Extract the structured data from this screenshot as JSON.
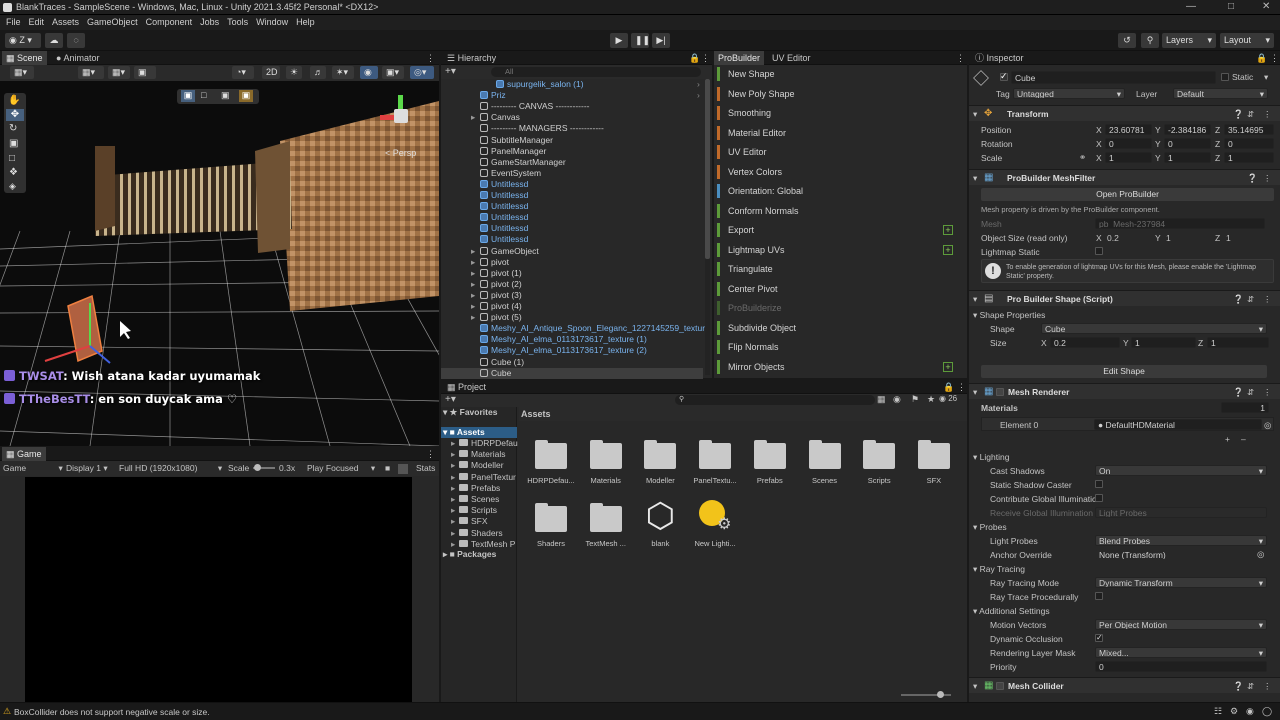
{
  "window": {
    "title": "BlankTraces - SampleScene - Windows, Mac, Linux - Unity 2021.3.45f2 Personal* <DX12>"
  },
  "menu": [
    "File",
    "Edit",
    "Assets",
    "GameObject",
    "Component",
    "Jobs",
    "Tools",
    "Window",
    "Help"
  ],
  "toolbar": {
    "account": "Z",
    "layers": "Layers",
    "layout": "Layout"
  },
  "scene": {
    "tab_scene": "Scene",
    "tab_animator": "Animator",
    "mode_2d": "2D",
    "persp": "< Persp"
  },
  "chat": [
    {
      "user": "TWSAT",
      "msg": ": Wish atana kadar uyumamak"
    },
    {
      "user": "TTheBesTT",
      "msg": ": en son duycak ama ♡"
    }
  ],
  "game": {
    "tab": "Game",
    "display_mode": "Game",
    "display": "Display 1",
    "resolution": "Full HD (1920x1080)",
    "scale_label": "Scale",
    "scale_value": "0.3x",
    "play_focused": "Play Focused",
    "stats": "Stats"
  },
  "hierarchy": {
    "tab": "Hierarchy",
    "search_placeholder": "All",
    "items": [
      {
        "text": "supurgelik_salon (1)",
        "indent": 3,
        "prefab": true
      },
      {
        "text": "Priz",
        "indent": 2,
        "prefab": true
      },
      {
        "text": "--------- CANVAS ------------",
        "indent": 2,
        "prefab": false
      },
      {
        "text": "Canvas",
        "indent": 2,
        "prefab": false,
        "arrow": true
      },
      {
        "text": "--------- MANAGERS ------------",
        "indent": 2,
        "prefab": false
      },
      {
        "text": "SubtitleManager",
        "indent": 2,
        "prefab": false
      },
      {
        "text": "PanelManager",
        "indent": 2,
        "prefab": false
      },
      {
        "text": "GameStartManager",
        "indent": 2,
        "prefab": false
      },
      {
        "text": "EventSystem",
        "indent": 2,
        "prefab": false
      },
      {
        "text": "Untitlessd",
        "indent": 2,
        "prefab": true
      },
      {
        "text": "Untitlessd",
        "indent": 2,
        "prefab": true
      },
      {
        "text": "Untitlessd",
        "indent": 2,
        "prefab": true
      },
      {
        "text": "Untitlessd",
        "indent": 2,
        "prefab": true
      },
      {
        "text": "Untitlessd",
        "indent": 2,
        "prefab": true
      },
      {
        "text": "Untitlessd",
        "indent": 2,
        "prefab": true
      },
      {
        "text": "GameObject",
        "indent": 2,
        "prefab": false,
        "arrow": true
      },
      {
        "text": "pivot",
        "indent": 2,
        "prefab": false,
        "arrow": true
      },
      {
        "text": "pivot (1)",
        "indent": 2,
        "prefab": false,
        "arrow": true
      },
      {
        "text": "pivot (2)",
        "indent": 2,
        "prefab": false,
        "arrow": true
      },
      {
        "text": "pivot (3)",
        "indent": 2,
        "prefab": false,
        "arrow": true
      },
      {
        "text": "pivot (4)",
        "indent": 2,
        "prefab": false,
        "arrow": true
      },
      {
        "text": "pivot (5)",
        "indent": 2,
        "prefab": false,
        "arrow": true
      },
      {
        "text": "Meshy_AI_Antique_Spoon_Eleganc_1227145259_texture",
        "indent": 2,
        "prefab": true
      },
      {
        "text": "Meshy_AI_elma_0113173617_texture (1)",
        "indent": 2,
        "prefab": true
      },
      {
        "text": "Meshy_AI_elma_0113173617_texture (2)",
        "indent": 2,
        "prefab": true
      },
      {
        "text": "Cube (1)",
        "indent": 2,
        "prefab": false
      },
      {
        "text": "Cube",
        "indent": 2,
        "prefab": false,
        "selected": true
      }
    ]
  },
  "probuilder": {
    "tab": "ProBuilder",
    "tab2": "UV Editor",
    "items": [
      {
        "label": "New Shape",
        "color": "#5d9b3a"
      },
      {
        "label": "New Poly Shape",
        "color": "#c06a2a"
      },
      {
        "label": "Smoothing",
        "color": "#c06a2a"
      },
      {
        "label": "Material Editor",
        "color": "#c06a2a"
      },
      {
        "label": "UV Editor",
        "color": "#c06a2a"
      },
      {
        "label": "Vertex Colors",
        "color": "#c06a2a"
      },
      {
        "label": "Orientation: Global",
        "color": "#4a8ec0"
      },
      {
        "label": "Conform Normals",
        "color": "#5d9b3a"
      },
      {
        "label": "Export",
        "color": "#5d9b3a",
        "plus": true
      },
      {
        "label": "Lightmap UVs",
        "color": "#5d9b3a",
        "plus": true
      },
      {
        "label": "Triangulate",
        "color": "#5d9b3a"
      },
      {
        "label": "Center Pivot",
        "color": "#5d9b3a"
      },
      {
        "label": "ProBuilderize",
        "color": "#3f5f2e",
        "dim": true
      },
      {
        "label": "Subdivide Object",
        "color": "#5d9b3a"
      },
      {
        "label": "Flip Normals",
        "color": "#5d9b3a"
      },
      {
        "label": "Mirror Objects",
        "color": "#5d9b3a",
        "plus": true
      }
    ]
  },
  "project": {
    "tab": "Project",
    "favorites": "Favorites",
    "assets_root": "Assets",
    "packages": "Packages",
    "breadcrumb": "Assets",
    "count": "26",
    "tree": [
      "HDRPDefau",
      "Materials",
      "Modeller",
      "PanelTextur",
      "Prefabs",
      "Scenes",
      "Scripts",
      "SFX",
      "Shaders",
      "TextMesh P"
    ],
    "grid": [
      {
        "label": "HDRPDefau...",
        "kind": "folder"
      },
      {
        "label": "Materials",
        "kind": "folder"
      },
      {
        "label": "Modeller",
        "kind": "folder"
      },
      {
        "label": "PanelTextu...",
        "kind": "folder"
      },
      {
        "label": "Prefabs",
        "kind": "folder"
      },
      {
        "label": "Scenes",
        "kind": "folder"
      },
      {
        "label": "Scripts",
        "kind": "folder"
      },
      {
        "label": "SFX",
        "kind": "folder"
      },
      {
        "label": "Shaders",
        "kind": "folder"
      },
      {
        "label": "TextMesh ...",
        "kind": "folder"
      },
      {
        "label": "blank",
        "kind": "unity"
      },
      {
        "label": "New Lighti...",
        "kind": "light"
      }
    ]
  },
  "inspector": {
    "tab": "Inspector",
    "name": "Cube",
    "static": "Static",
    "tag_label": "Tag",
    "tag": "Untagged",
    "layer_label": "Layer",
    "layer": "Default",
    "transform": {
      "title": "Transform",
      "position_label": "Position",
      "rotation_label": "Rotation",
      "scale_label": "Scale",
      "px": "23.60781",
      "py": "-2.384186",
      "pz": "35.14695",
      "rx": "0",
      "ry": "0",
      "rz": "0",
      "sx": "1",
      "sy": "1",
      "sz": "1"
    },
    "meshfilter": {
      "title": "ProBuilder MeshFilter",
      "open_btn": "Open ProBuilder",
      "note": "Mesh property is driven by the ProBuilder component.",
      "mesh_label": "Mesh",
      "mesh_value": "pb_Mesh-237984",
      "objsize_label": "Object Size (read only)",
      "ox": "0.2",
      "oy": "1",
      "oz": "1",
      "lightmap_label": "Lightmap Static",
      "warn": "To enable generation of lightmap UVs for this Mesh, please enable the 'Lightmap Static' property."
    },
    "shape": {
      "title": "Pro Builder Shape (Script)",
      "props": "Shape Properties",
      "shape_label": "Shape",
      "shape_value": "Cube",
      "size_label": "Size",
      "x": "0.2",
      "y": "1",
      "z": "1",
      "edit_btn": "Edit Shape"
    },
    "renderer": {
      "title": "Mesh Renderer",
      "materials": "Materials",
      "materials_count": "1",
      "element0": "Element 0",
      "material": "DefaultHDMaterial",
      "lighting": "Lighting",
      "cast_shadows_label": "Cast Shadows",
      "cast_shadows": "On",
      "static_shadow": "Static Shadow Caster",
      "contribute_gi": "Contribute Global Illuminatic",
      "receive_gi": "Receive Global Illumination",
      "receive_gi_value": "Light Probes",
      "probes": "Probes",
      "light_probes_label": "Light Probes",
      "light_probes": "Blend Probes",
      "anchor_label": "Anchor Override",
      "anchor": "None (Transform)",
      "ray_tracing": "Ray Tracing",
      "rt_mode_label": "Ray Tracing Mode",
      "rt_mode": "Dynamic Transform",
      "rt_proc": "Ray Trace Procedurally",
      "additional": "Additional Settings",
      "motion_label": "Motion Vectors",
      "motion": "Per Object Motion",
      "dyn_occ": "Dynamic Occlusion",
      "rlm_label": "Rendering Layer Mask",
      "rlm": "Mixed...",
      "priority_label": "Priority",
      "priority": "0"
    },
    "collider": {
      "title": "Mesh Collider"
    }
  },
  "status": {
    "warning": "BoxCollider does not support negative scale or size."
  }
}
